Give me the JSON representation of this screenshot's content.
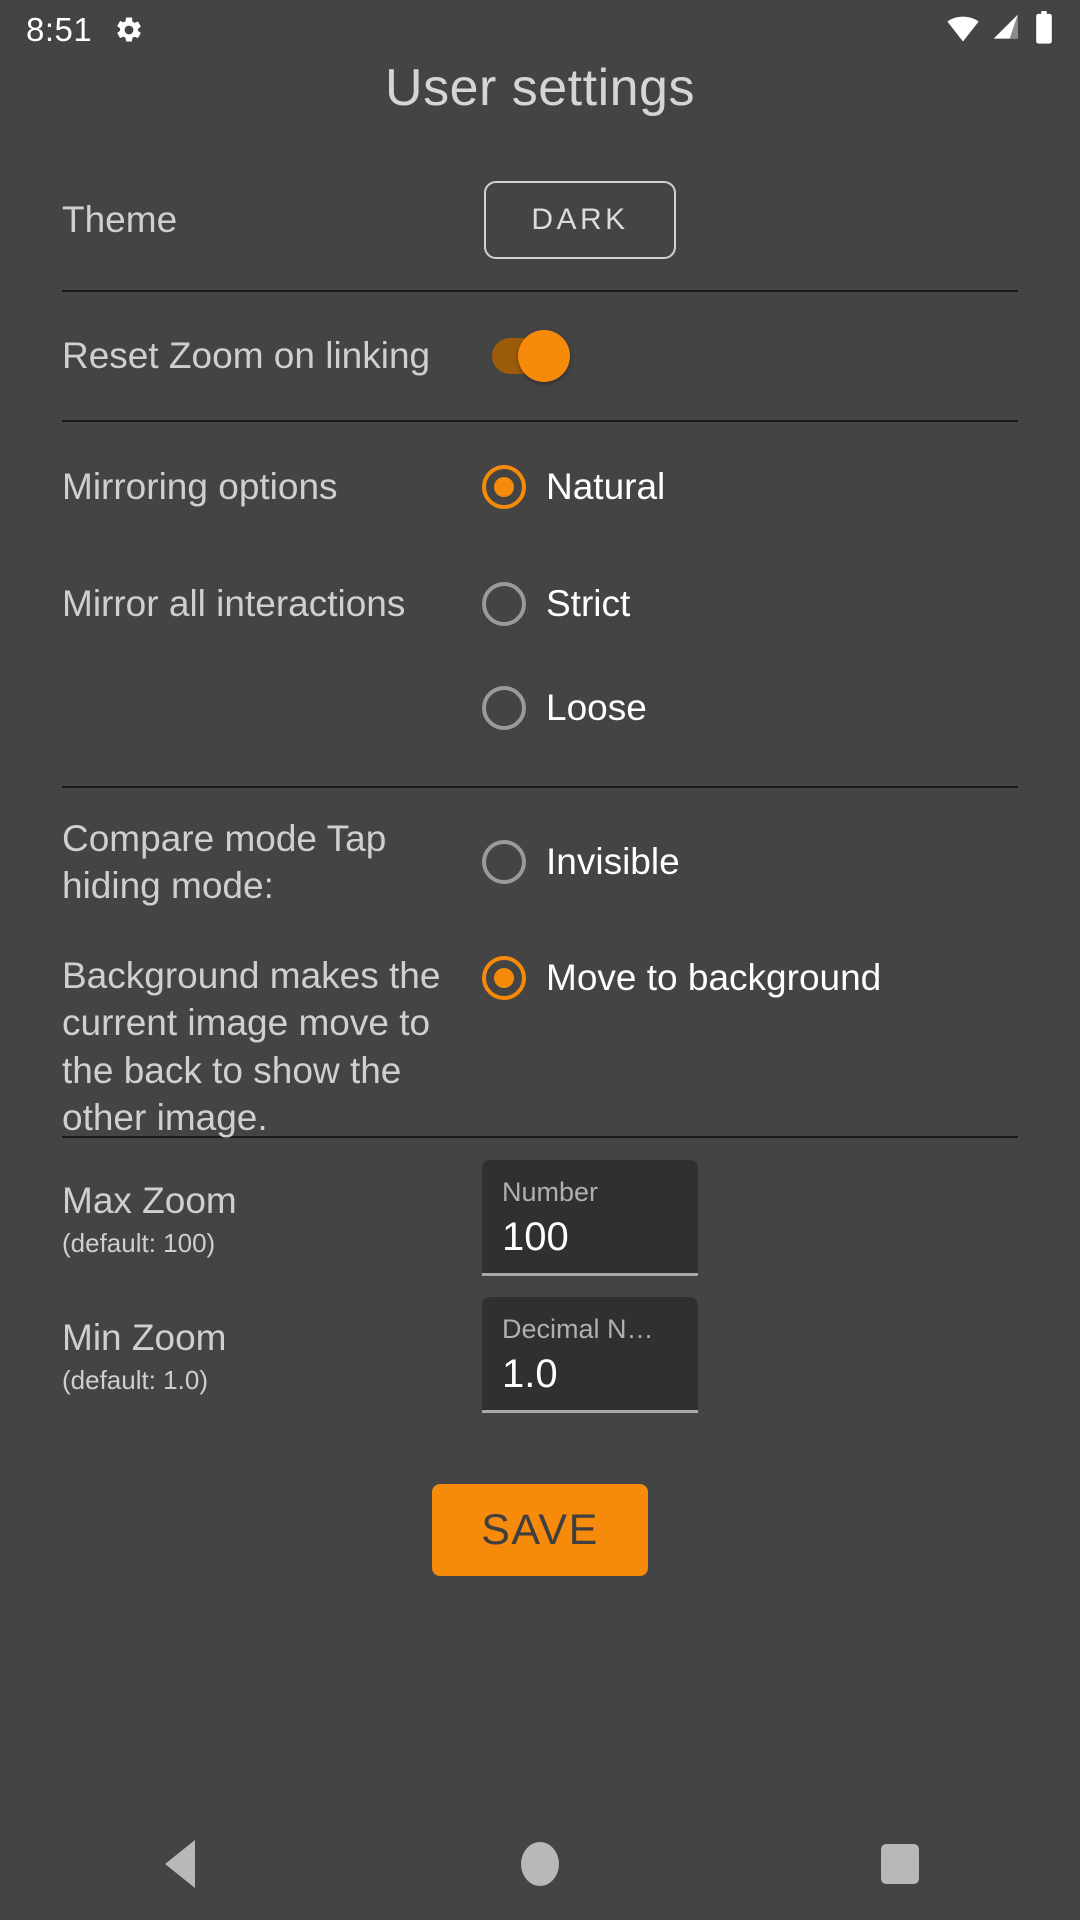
{
  "status_bar": {
    "time": "8:51",
    "gear_icon": "gear-icon",
    "wifi_icon": "wifi-icon",
    "signal_icon": "cellular-signal-icon",
    "battery_icon": "battery-full-icon"
  },
  "header": {
    "title": "User settings"
  },
  "theme": {
    "label": "Theme",
    "button_value": "DARK"
  },
  "reset_zoom": {
    "label": "Reset Zoom on linking",
    "switch_state": "on"
  },
  "mirroring": {
    "label_1": "Mirroring options",
    "label_2": "Mirror all interactions",
    "options": [
      {
        "label": "Natural",
        "selected": true
      },
      {
        "label": "Strict",
        "selected": false
      },
      {
        "label": "Loose",
        "selected": false
      }
    ]
  },
  "compare_mode": {
    "label_1": "Compare mode Tap hiding mode:",
    "label_2": "Background makes the current image move to the back to show the other image.",
    "options": [
      {
        "label": "Invisible",
        "selected": false
      },
      {
        "label": "Move to background",
        "selected": true
      }
    ]
  },
  "max_zoom": {
    "label": "Max Zoom",
    "sublabel": "(default: 100)",
    "field_label": "Number",
    "field_value": "100"
  },
  "min_zoom": {
    "label": "Min Zoom",
    "sublabel": "(default: 1.0)",
    "field_label": "Decimal N…",
    "field_value": "1.0"
  },
  "save": {
    "label": "SAVE"
  },
  "nav_bar": {
    "back": "back-button",
    "home": "home-button",
    "recents": "recents-button"
  },
  "colors": {
    "accent": "#f58a0b",
    "accent_track": "#9c5c0a",
    "background": "#444444",
    "field_background": "#303030",
    "divider": "#1a1a1a"
  }
}
